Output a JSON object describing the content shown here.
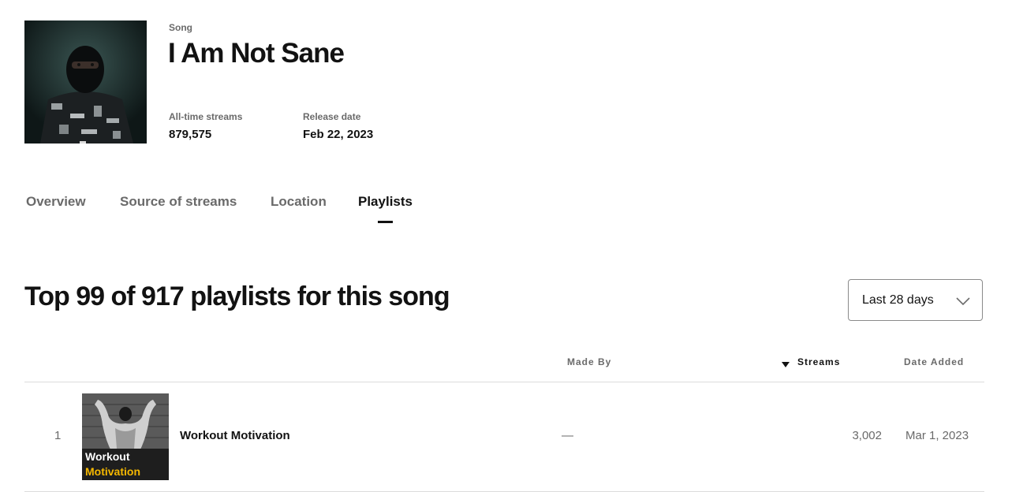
{
  "song": {
    "kind": "Song",
    "title": "I Am Not Sane",
    "stats": [
      {
        "label": "All-time streams",
        "value": "879,575"
      },
      {
        "label": "Release date",
        "value": "Feb 22, 2023"
      }
    ]
  },
  "tabs": [
    "Overview",
    "Source of streams",
    "Location",
    "Playlists"
  ],
  "active_tab": "Playlists",
  "section": {
    "title": "Top 99 of 917 playlists for this song",
    "range": "Last 28 days"
  },
  "table": {
    "columns": {
      "made_by": "Made By",
      "streams": "Streams",
      "date_added": "Date Added"
    },
    "rows": [
      {
        "rank": "1",
        "name": "Workout Motivation",
        "thumb_line1": "Workout",
        "thumb_line2": "Motivation",
        "made_by": "—",
        "streams": "3,002",
        "date_added": "Mar 1, 2023"
      }
    ]
  },
  "colors": {
    "text": "#121212",
    "muted": "#6a6a6a",
    "thumb_accent": "#f5b800"
  }
}
